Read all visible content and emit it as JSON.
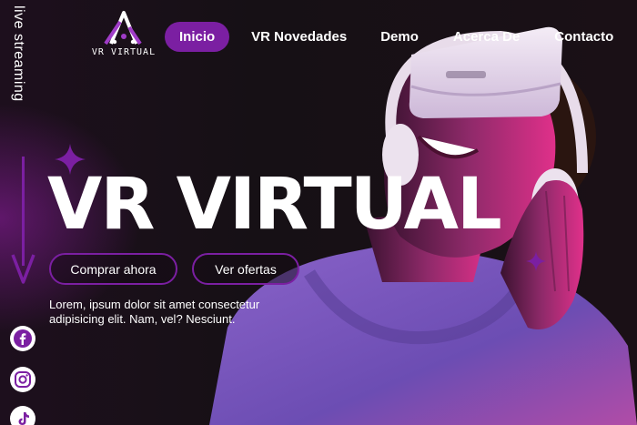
{
  "sidebar": {
    "vertical_label": "live streaming",
    "social": [
      {
        "icon": "facebook-icon"
      },
      {
        "icon": "instagram-icon"
      },
      {
        "icon": "tiktok-icon"
      }
    ]
  },
  "logo": {
    "text": "VR VIRTUAL"
  },
  "nav": {
    "items": [
      "Inicio",
      "VR Novedades",
      "Demo",
      "Acerca De",
      "Contacto"
    ],
    "active_index": 0
  },
  "hero": {
    "title": "VR VIRTUAL",
    "buttons": {
      "buy": "Comprar ahora",
      "offers": "Ver ofertas"
    },
    "description": "Lorem, ipsum dolor sit amet consectetur adipisicing elit. Nam, vel? Nesciunt."
  },
  "colors": {
    "accent": "#7b1fa2",
    "background": "#1a1118",
    "text": "#ffffff"
  }
}
